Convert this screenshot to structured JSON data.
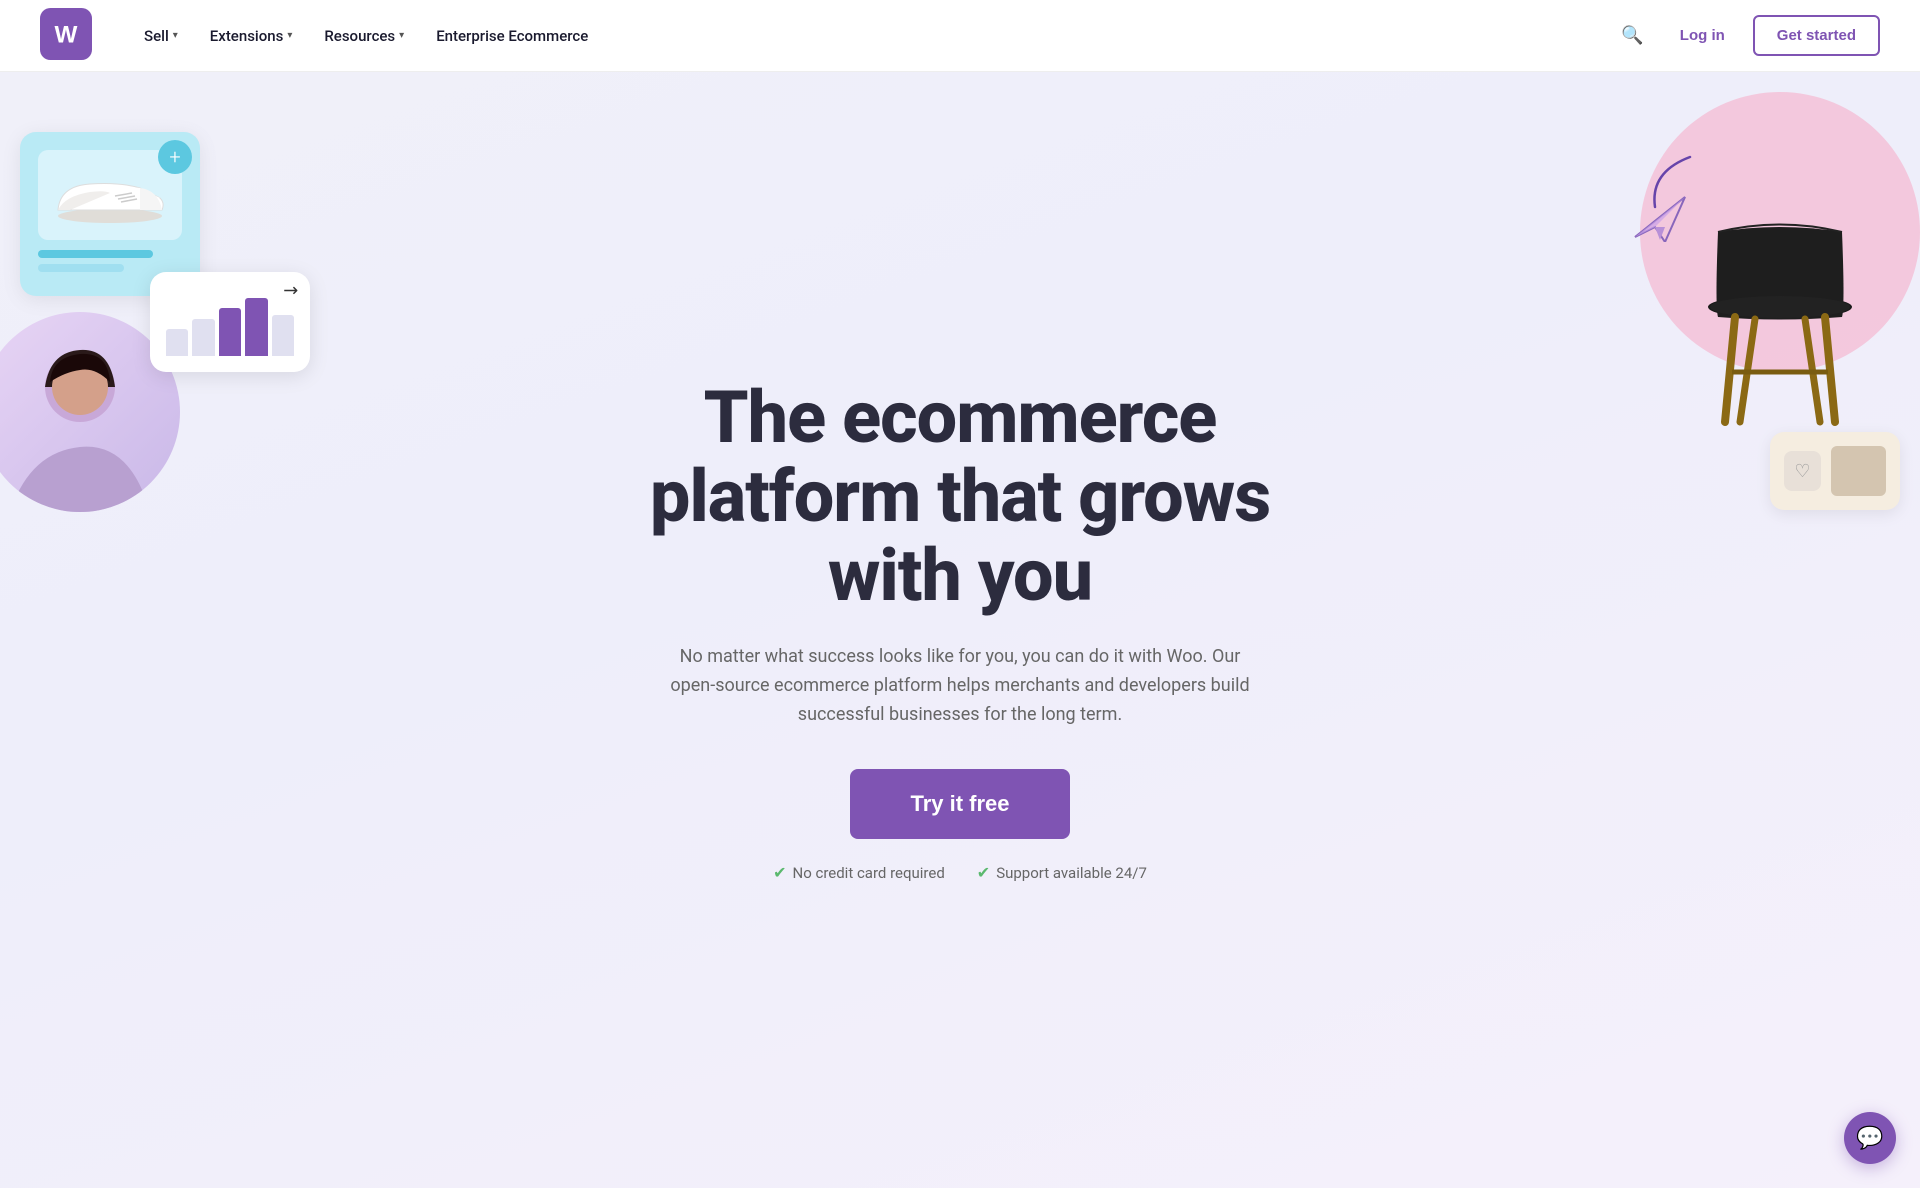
{
  "nav": {
    "logo_alt": "WooCommerce",
    "links": [
      {
        "label": "Sell",
        "has_dropdown": true
      },
      {
        "label": "Extensions",
        "has_dropdown": true
      },
      {
        "label": "Resources",
        "has_dropdown": true
      },
      {
        "label": "Enterprise Ecommerce",
        "has_dropdown": false
      }
    ],
    "login_label": "Log in",
    "get_started_label": "Get started"
  },
  "hero": {
    "title": "The ecommerce platform that grows with you",
    "subtitle": "No matter what success looks like for you, you can do it with Woo. Our open-source ecommerce platform helps merchants and developers build successful businesses for the long term.",
    "cta_label": "Try it free",
    "badge1": "No credit card required",
    "badge2": "Support available 24/7"
  },
  "chat": {
    "icon": "💬"
  },
  "colors": {
    "brand_purple": "#7f54b3",
    "accent_teal": "#5cc8e0",
    "accent_pink": "#f5b8d0",
    "check_green": "#5bb96e"
  }
}
